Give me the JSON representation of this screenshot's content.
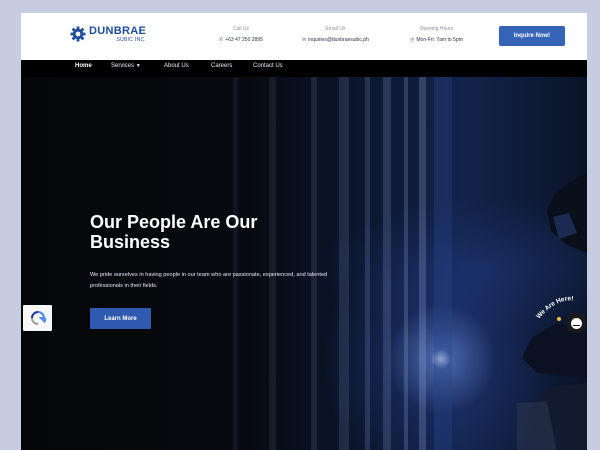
{
  "brand": {
    "name": "DUNBRAE",
    "sub": "SUBIC INC."
  },
  "contacts": [
    {
      "label": "Call Us",
      "value": "+63 47 250 2895",
      "icon": "phone-icon"
    },
    {
      "label": "Email Us",
      "value": "inquiries@dunbraesubic.ph",
      "icon": "mail-icon"
    },
    {
      "label": "Opening Hours",
      "value": "Mon-Fri: 7am to 5pm",
      "icon": "clock-icon"
    }
  ],
  "inquire_label": "Inquire Now!",
  "nav": {
    "home": "Home",
    "services": "Services",
    "about": "About Us",
    "careers": "Careers",
    "contact": "Contact Us"
  },
  "hero": {
    "title": "Our People Are Our Business",
    "description": "We pride ourselves in having people in our team who are passionate, experienced, and talented professionals in their fields.",
    "button": "Learn More"
  },
  "chat": {
    "badge": "We Are Here!"
  },
  "colors": {
    "brand": "#1f4d9a",
    "accent": "#3563b8",
    "nav_bg": "#000000"
  }
}
